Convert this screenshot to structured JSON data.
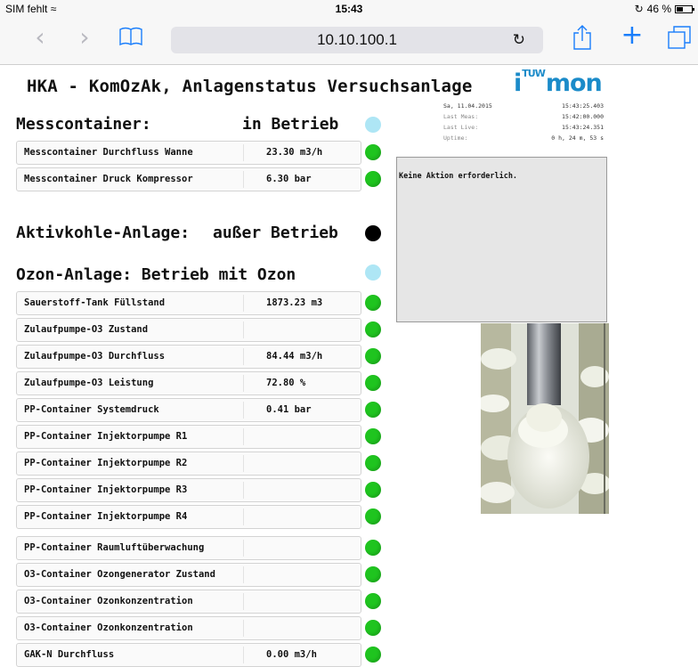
{
  "statusbar": {
    "carrier": "SIM fehlt",
    "time": "15:43",
    "battery": "46 %"
  },
  "browser": {
    "url": "10.10.100.1"
  },
  "page": {
    "title": "HKA - KomOzAk, Anlagenstatus Versuchsanlage",
    "logo_prefix": "i",
    "logo_sup": "TUW",
    "logo_suffix": "mon"
  },
  "info": {
    "date_label": "Sa, 11.04.2015",
    "date_value": "15:43:25.403",
    "meas_label": "Last Meas:",
    "meas_value": "15:42:00.000",
    "live_label": "Last Live:",
    "live_value": "15:43:24.351",
    "uptime_label": "Uptime:",
    "uptime_value": "0 h,  24 m,  53 s"
  },
  "message": "Keine Aktion erforderlich.",
  "colors": {
    "ok": "#1fc41f",
    "inactive": "#000000",
    "idle": "#aee6f5",
    "accent": "#1a7efb",
    "logo": "#1b8bc9"
  },
  "sections": {
    "mess": {
      "title": "Messcontainer:",
      "status": "in Betrieb",
      "dot": "idle",
      "rows": [
        {
          "label": "Messcontainer Durchfluss Wanne",
          "value": "23.30 m3/h"
        },
        {
          "label": "Messcontainer Druck Kompressor",
          "value": "6.30 bar"
        }
      ]
    },
    "aktiv": {
      "title": "Aktivkohle-Anlage:",
      "status": "außer Betrieb",
      "dot": "inactive"
    },
    "ozon": {
      "title": "Ozon-Anlage: Betrieb mit Ozon",
      "dot": "idle",
      "rows": [
        {
          "label": "Sauerstoff-Tank Füllstand",
          "value": "1873.23 m3"
        },
        {
          "label": "Zulaufpumpe-O3 Zustand",
          "value": ""
        },
        {
          "label": "Zulaufpumpe-O3 Durchfluss",
          "value": "84.44 m3/h"
        },
        {
          "label": "Zulaufpumpe-O3 Leistung",
          "value": "72.80 %"
        },
        {
          "label": "PP-Container Systemdruck",
          "value": "0.41 bar"
        },
        {
          "label": "PP-Container Injektorpumpe R1",
          "value": ""
        },
        {
          "label": "PP-Container Injektorpumpe R2",
          "value": ""
        },
        {
          "label": "PP-Container Injektorpumpe R3",
          "value": ""
        },
        {
          "label": "PP-Container Injektorpumpe R4",
          "value": ""
        },
        {
          "label": "PP-Container Raumluftüberwachung",
          "value": ""
        },
        {
          "label": "O3-Container Ozongenerator Zustand",
          "value": ""
        },
        {
          "label": "O3-Container Ozonkonzentration",
          "value": ""
        },
        {
          "label": "O3-Container Ozonkonzentration",
          "value": ""
        },
        {
          "label": "GAK-N Durchfluss",
          "value": "0.00 m3/h"
        }
      ]
    }
  }
}
